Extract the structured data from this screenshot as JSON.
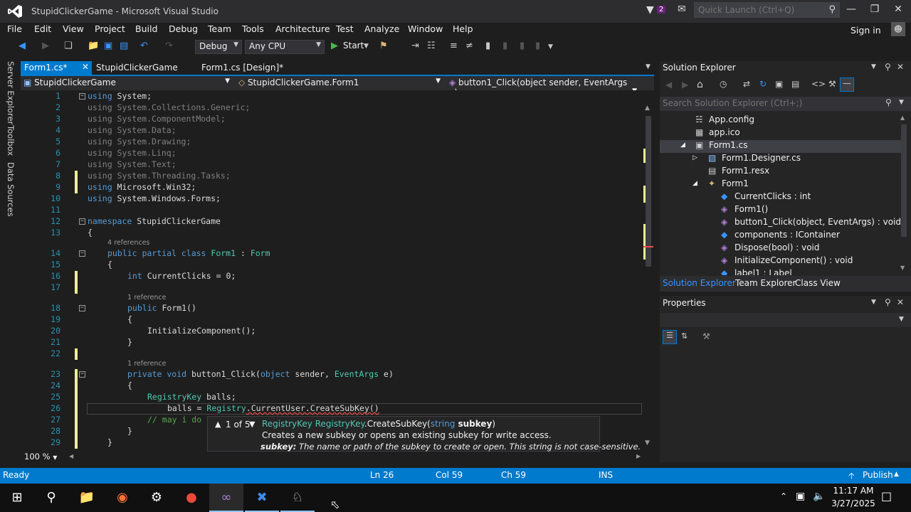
{
  "window": {
    "title": "StupidClickerGame - Microsoft Visual Studio",
    "notification_count": "2",
    "quick_launch_placeholder": "Quick Launch (Ctrl+Q)",
    "sign_in": "Sign in"
  },
  "menu": [
    "File",
    "Edit",
    "View",
    "Project",
    "Build",
    "Debug",
    "Team",
    "Tools",
    "Architecture",
    "Test",
    "Analyze",
    "Window",
    "Help"
  ],
  "toolbar": {
    "config": "Debug",
    "platform": "Any CPU",
    "start": "Start"
  },
  "side_tabs": [
    "Server Explorer",
    "Toolbox",
    "Data Sources"
  ],
  "tabs": [
    {
      "label": "Form1.cs*"
    },
    {
      "label": "StupidClickerGame"
    },
    {
      "label": "Form1.cs [Design]*"
    }
  ],
  "navbar": {
    "project": "StupidClickerGame",
    "class": "StupidClickerGame.Form1",
    "member": "button1_Click(object sender, EventArgs e)"
  },
  "code": {
    "l1": "using",
    "l1b": " System;",
    "l2": "using System.Collections.Generic;",
    "l3": "using System.ComponentModel;",
    "l4": "using System.Data;",
    "l5": "using System.Drawing;",
    "l6": "using System.Linq;",
    "l7": "using System.Text;",
    "l8": "using System.Threading.Tasks;",
    "l9a": "using",
    "l9b": " Microsoft.Win32;",
    "l10a": "using",
    "l10b": " System.Windows.Forms;",
    "l12a": "namespace",
    "l12b": " StupidClickerGame",
    "l13": "{",
    "lens14": "4 references",
    "l14a": "public partial class ",
    "l14b": "Form1",
    "l14c": " : ",
    "l14d": "Form",
    "l15": "{",
    "l16a": "int",
    "l16b": " CurrentClicks = 0;",
    "lens18": "1 reference",
    "l18a": "public ",
    "l18b": "Form1",
    "l18c": "()",
    "l19": "{",
    "l20": "InitializeComponent();",
    "l21": "}",
    "lens23": "1 reference",
    "l23a": "private void ",
    "l23b": "button1_Click(",
    "l23c": "object",
    " l23d": "",
    "l23e": " sender, ",
    "l23f": "EventArgs",
    "l23g": " e)",
    "l24": "{",
    "l25a": "RegistryKey",
    "l25b": " balls;",
    "l26a": "balls = ",
    "l26b": "Registry",
    ".l26c": "",
    "l26d": ".CurrentUser.CreateSubKey()",
    "l27": "// may i do",
    "l28": "}",
    "l29": "}"
  },
  "line_numbers": [
    "1",
    "2",
    "3",
    "4",
    "5",
    "6",
    "7",
    "8",
    "9",
    "10",
    "11",
    "12",
    "13",
    "14",
    "15",
    "16",
    "17",
    "18",
    "19",
    "20",
    "21",
    "22",
    "23",
    "24",
    "25",
    "26",
    "27",
    "28",
    "29"
  ],
  "tooltip": {
    "counter": "1 of 5",
    "sig_ret": "RegistryKey",
    "sig_cls": "RegistryKey",
    "sig_method": ".CreateSubKey(",
    "sig_ptype": "string",
    "sig_pname": " subkey",
    ".sig_close": "",
    "sig_end": ")",
    "desc": "Creates a new subkey or opens an existing subkey for write access.",
    "param_name": "subkey:",
    "param_desc": " The name or path of the subkey to create or open. This string is not case-sensitive."
  },
  "zoom": "100 %",
  "solution_explorer": {
    "title": "Solution Explorer",
    "search_placeholder": "Search Solution Explorer (Ctrl+;)",
    "items": [
      {
        "label": "App.config"
      },
      {
        "label": "app.ico"
      },
      {
        "label": "Form1.cs"
      },
      {
        "label": "Form1.Designer.cs"
      },
      {
        "label": "Form1.resx"
      },
      {
        "label": "Form1"
      },
      {
        "label": "CurrentClicks : int"
      },
      {
        "label": "Form1()"
      },
      {
        "label": "button1_Click(object, EventArgs) : void"
      },
      {
        "label": "components : IContainer"
      },
      {
        "label": "Dispose(bool) : void"
      },
      {
        "label": "InitializeComponent() : void"
      },
      {
        "label": "label1 : Label"
      }
    ],
    "bottom_tabs": [
      "Solution Explorer",
      "Team Explorer",
      "Class View"
    ]
  },
  "properties": {
    "title": "Properties"
  },
  "status": {
    "ready": "Ready",
    "ln": "Ln 26",
    "col": "Col 59",
    "ch": "Ch 59",
    "ins": "INS",
    "publish": "Publish"
  },
  "taskbar": {
    "time": "11:17 AM",
    "date": "3/27/2025"
  },
  "colors": {
    "accent": "#007acc",
    "background": "#1e1e1e",
    "chrome": "#2d2d30"
  }
}
